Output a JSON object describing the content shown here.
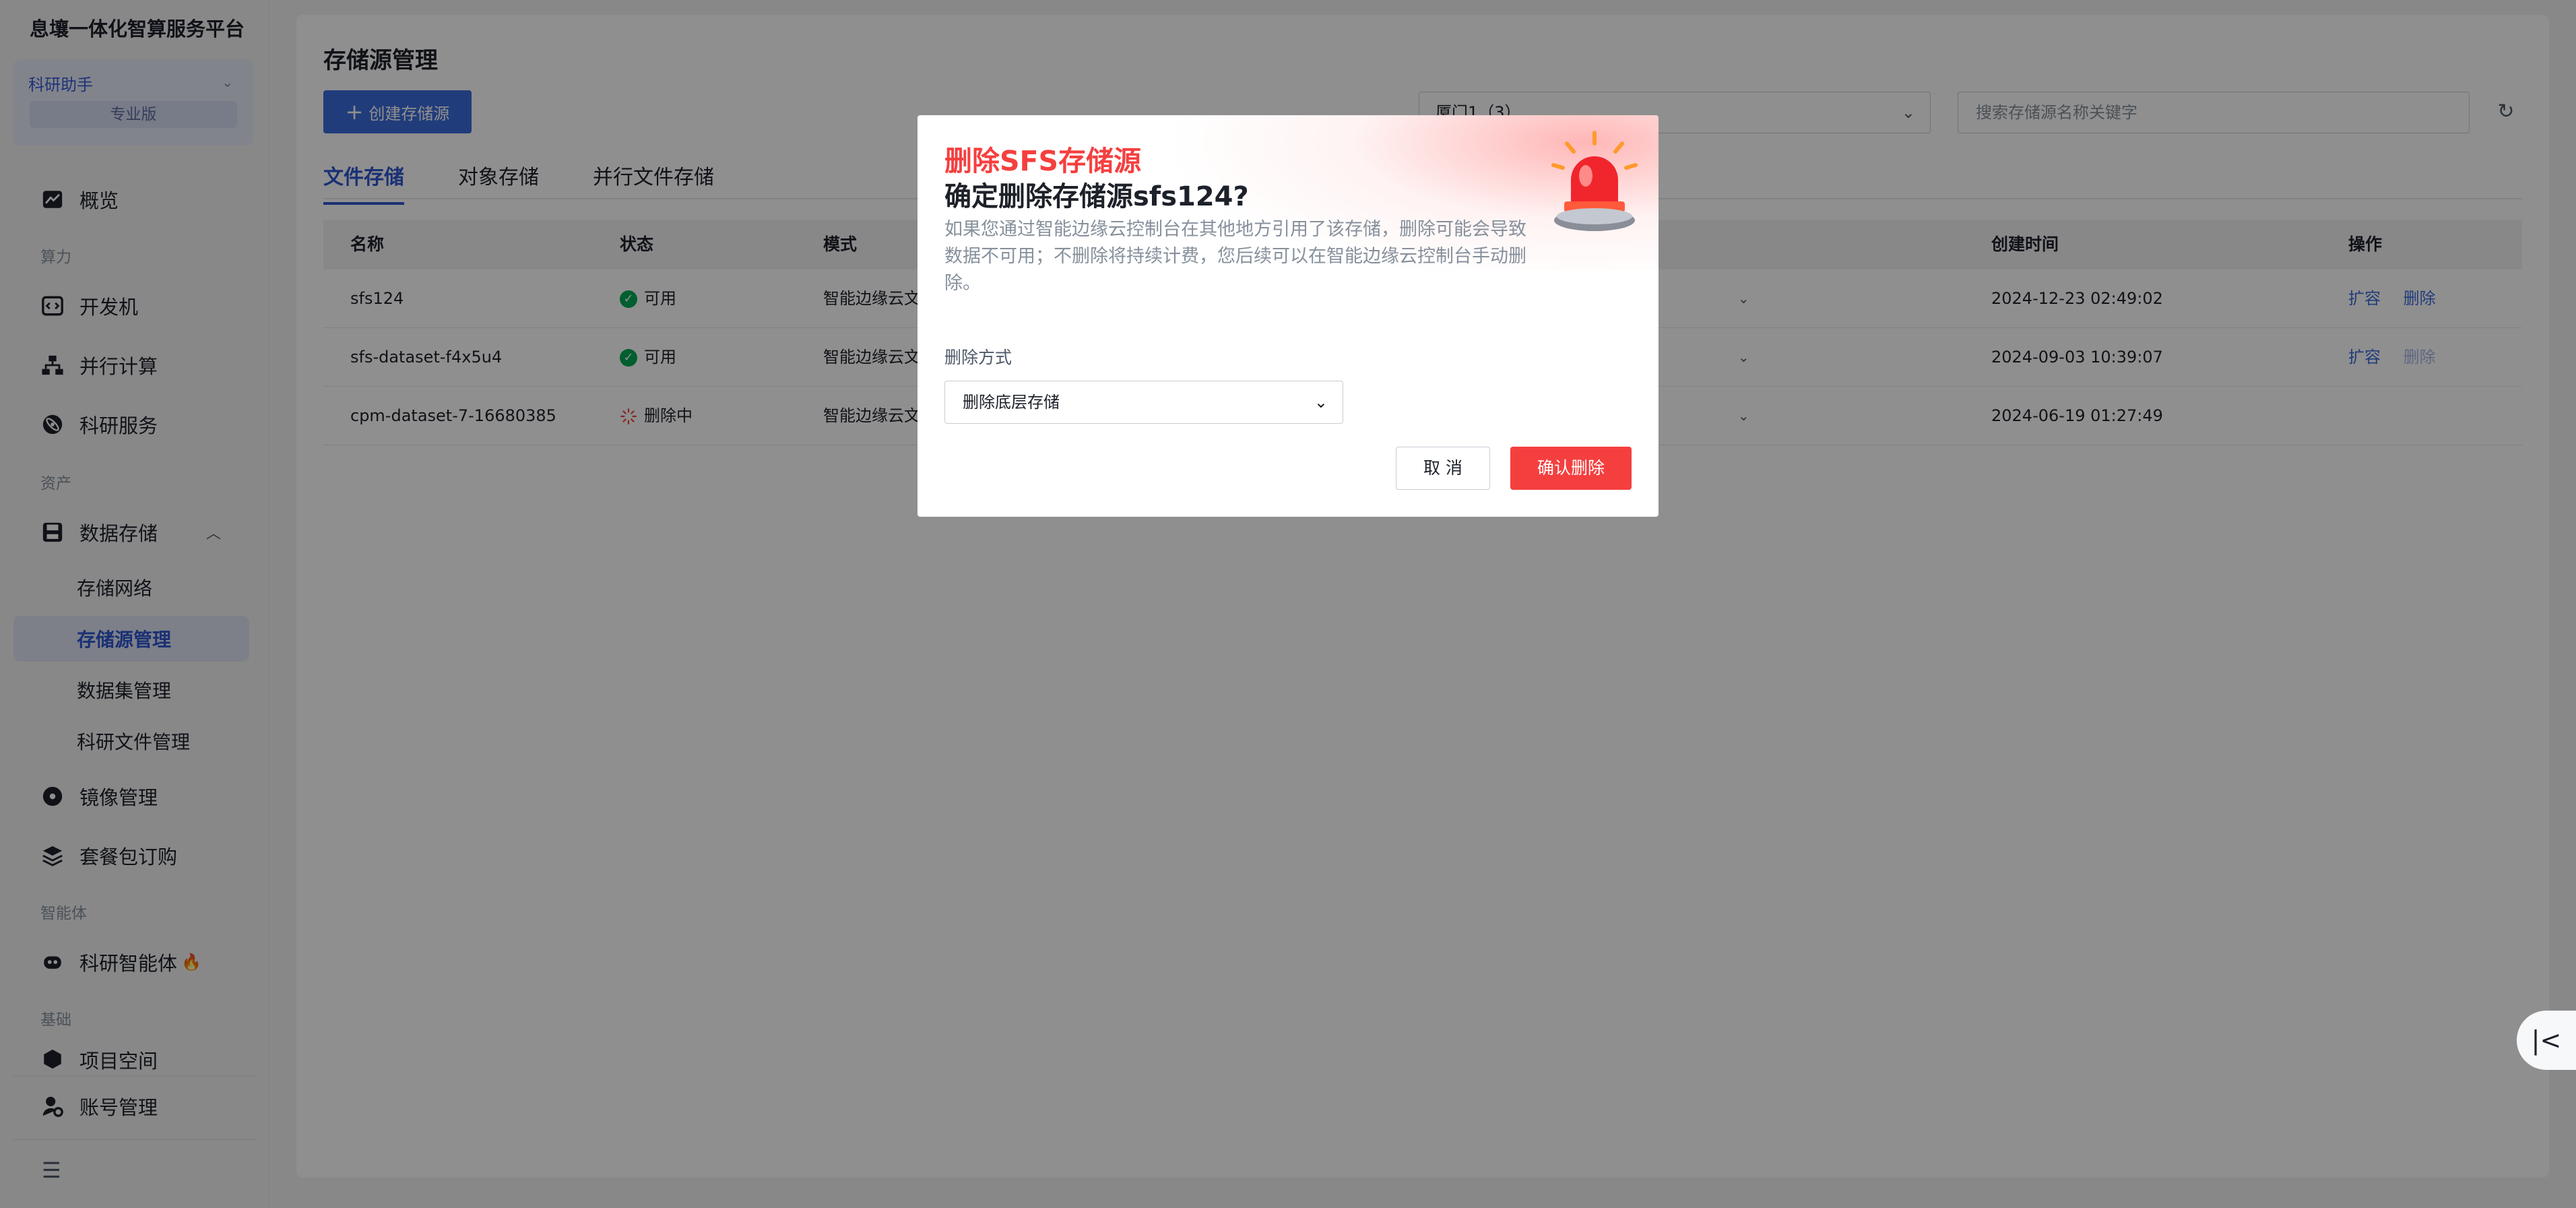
{
  "app": {
    "title": "息壤一体化智算服务平台"
  },
  "workspace": {
    "name": "科研助手",
    "edition": "专业版"
  },
  "sidebar": {
    "items": [
      {
        "label": "概览",
        "icon": "chart-icon"
      },
      {
        "group": "算力"
      },
      {
        "label": "开发机",
        "icon": "code-icon"
      },
      {
        "label": "并行计算",
        "icon": "hierarchy-icon"
      },
      {
        "label": "科研服务",
        "icon": "atom-icon"
      },
      {
        "group": "资产"
      },
      {
        "label": "数据存储",
        "icon": "disk-icon"
      },
      {
        "label": "镜像管理",
        "icon": "disc-icon"
      },
      {
        "label": "套餐包订购",
        "icon": "layers-icon"
      },
      {
        "group": "智能体"
      },
      {
        "label": "科研智能体",
        "icon": "robot-icon"
      },
      {
        "group": "基础"
      },
      {
        "label": "项目空间",
        "icon": "project-icon"
      },
      {
        "label": "账号管理",
        "icon": "user-gear-icon"
      }
    ],
    "sub_items": [
      "存储网络",
      "存储源管理",
      "数据集管理",
      "科研文件管理"
    ],
    "groups": {
      "compute": "算力",
      "assets": "资产",
      "agent": "智能体",
      "base": "基础"
    }
  },
  "page": {
    "title": "存储源管理",
    "create_button": "创建存储源",
    "workspace_select": "厦门1（3）",
    "search_placeholder": "搜索存储源名称关键字",
    "tabs": [
      "文件存储",
      "对象存储",
      "并行文件存储"
    ]
  },
  "table": {
    "columns": [
      "名称",
      "状态",
      "模式",
      "创建时间",
      "操作"
    ],
    "rows": [
      {
        "name": "sfs124",
        "status": "可用",
        "mode": "智能边缘云文",
        "created": "2024-12-23 02:49:02",
        "actions": [
          "扩容",
          "删除"
        ]
      },
      {
        "name": "sfs-dataset-f4x5u4",
        "status": "可用",
        "mode": "智能边缘云文",
        "created": "2024-09-03 10:39:07",
        "actions": [
          "扩容",
          "删除"
        ]
      },
      {
        "name": "cpm-dataset-7-16680385",
        "status": "删除中",
        "mode": "智能边缘云文",
        "created": "2024-06-19 01:27:49",
        "actions": []
      }
    ]
  },
  "modal": {
    "title": "删除SFS存储源",
    "subtitle": "确定删除存储源sfs124?",
    "description": "如果您通过智能边缘云控制台在其他地方引用了该存储，删除可能会导致数据不可用；不删除将持续计费，您后续可以在智能边缘云控制台手动删除。",
    "method_label": "删除方式",
    "method_value": "删除底层存储",
    "cancel": "取 消",
    "confirm": "确认删除"
  },
  "colors": {
    "accent": "#3c6bdc",
    "danger": "#f53f3f",
    "success": "#00a854"
  }
}
